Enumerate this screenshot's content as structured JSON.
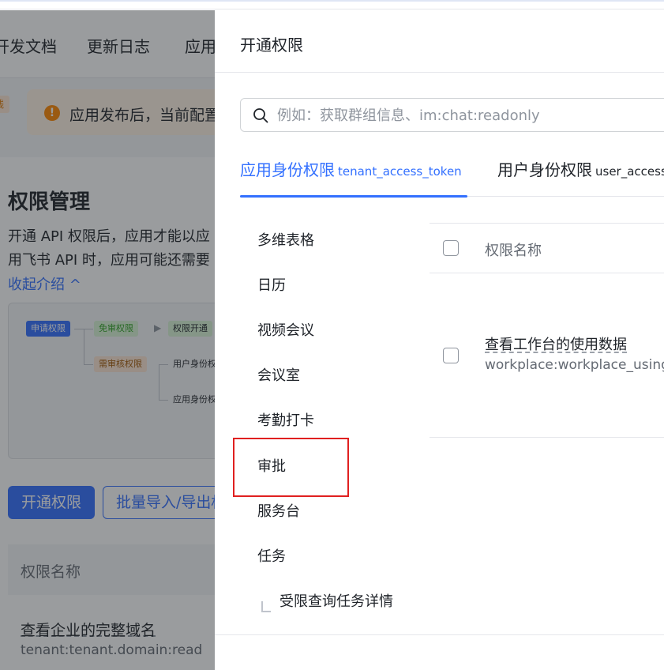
{
  "background_page": {
    "nav": [
      "开发文档",
      "更新日志",
      "应用"
    ],
    "left_tag": "线",
    "notice": "应用发布后，当前配置",
    "title": "权限管理",
    "desc_line1": "开通 API 权限后，应用才能以应",
    "desc_line2": "用飞书 API 时，应用可能还需要",
    "collapse_label": "收起介绍 ^",
    "flow": {
      "apply": "申请权限",
      "no_review": "免审权限",
      "granted": "权限开通",
      "need_review": "需审核权限",
      "user_identity": "用户身份权",
      "app_identity": "应用身份权"
    },
    "enable_button": "开通权限",
    "bulk_button": "批量导入/导出权",
    "table_header": "权限名称",
    "row_name": "查看企业的完整域名",
    "row_code": "tenant:tenant.domain:read"
  },
  "drawer": {
    "title": "开通权限",
    "search_placeholder": "例如：获取群组信息、im:chat:readonly",
    "tabs": [
      {
        "main": "应用身份权限",
        "sub": "tenant_access_token",
        "active": true
      },
      {
        "main": "用户身份权限",
        "sub": "user_access",
        "active": false
      }
    ],
    "categories": [
      "多维表格",
      "日历",
      "视频会议",
      "会议室",
      "考勤打卡",
      "审批",
      "服务台",
      "任务"
    ],
    "sub_category": "受限查询任务详情",
    "table": {
      "header": "权限名称",
      "rows": [
        {
          "name": "查看工作台的使用数据",
          "code": "workplace:workplace_using"
        }
      ]
    }
  },
  "colors": {
    "accent": "#3370ff",
    "highlight": "#e02020",
    "warning": "#ff8800"
  }
}
